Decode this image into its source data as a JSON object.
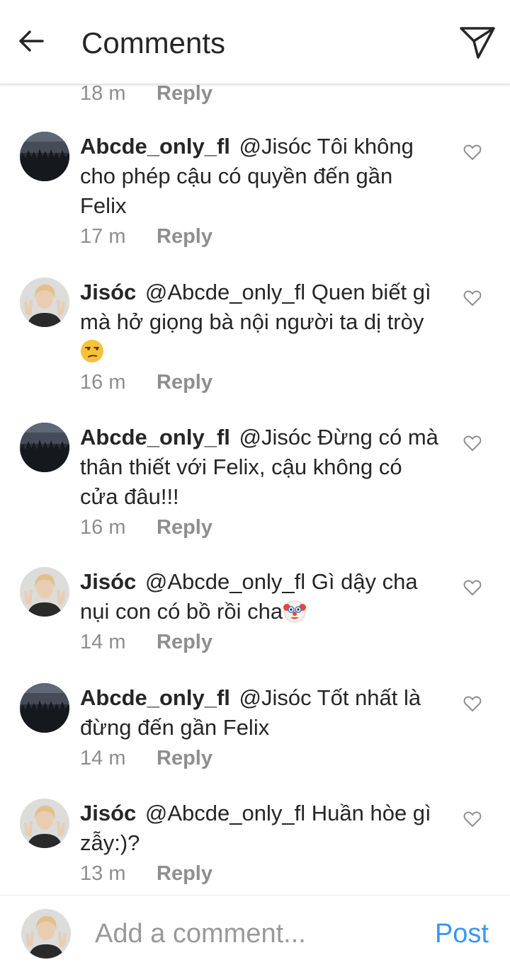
{
  "header": {
    "title": "Comments",
    "back_icon": "arrow-left-icon",
    "send_icon": "paper-plane-icon"
  },
  "partial_comment": {
    "time": "18 m",
    "reply_label": "Reply"
  },
  "comments": [
    {
      "username": "Abcde_only_fl",
      "text": "@Jisóc Tôi không cho phép cậu có quyền đến gần Felix",
      "emoji": "",
      "time": "17 m",
      "reply_label": "Reply",
      "avatar": "night-forest-avatar"
    },
    {
      "username": "Jisóc",
      "text": "@Abcde_only_fl Quen biết gì mà hở giọng bà nội người ta dị tròy",
      "emoji": "😒",
      "time": "16 m",
      "reply_label": "Reply",
      "avatar": "person-peace-sign-avatar"
    },
    {
      "username": "Abcde_only_fl",
      "text": "@Jisóc Đừng có mà thân thiết với Felix, cậu không có cửa đâu!!!",
      "emoji": "",
      "time": "16 m",
      "reply_label": "Reply",
      "avatar": "night-forest-avatar"
    },
    {
      "username": "Jisóc",
      "text": "@Abcde_only_fl Gì dậy cha nụi con có bồ rồi cha",
      "emoji": "🤡",
      "time": "14 m",
      "reply_label": "Reply",
      "avatar": "person-peace-sign-avatar"
    },
    {
      "username": "Abcde_only_fl",
      "text": "@Jisóc Tốt nhất là đừng đến gần Felix",
      "emoji": "",
      "time": "14 m",
      "reply_label": "Reply",
      "avatar": "night-forest-avatar"
    },
    {
      "username": "Jisóc",
      "text": "@Abcde_only_fl Huần hòe gì zẫy:)?",
      "emoji": "",
      "time": "13 m",
      "reply_label": "Reply",
      "avatar": "person-peace-sign-avatar"
    }
  ],
  "composer": {
    "placeholder": "Add a comment...",
    "post_label": "Post",
    "avatar": "person-peace-sign-avatar"
  },
  "colors": {
    "text": "#262626",
    "muted": "#8e8e8e",
    "accent": "#3897f0",
    "divider": "#e6e6e6"
  }
}
